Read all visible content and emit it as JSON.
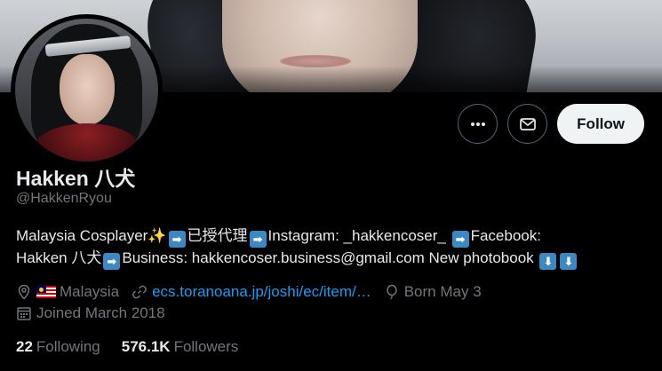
{
  "profile": {
    "display_name": "Hakken 八犬",
    "handle": "@HakkenRyou",
    "bio": {
      "line1_a": "Malaysia Cosplayer",
      "line1_b": "已授代理",
      "line1_c": "Instagram: _hakkencoser_",
      "line1_d": "Facebook:",
      "line2_a": "Hakken 八犬",
      "line2_b": "Business: hakkencoser.business@gmail.com  New photobook",
      "emoji_arrow": "➡",
      "emoji_down": "⬇",
      "emoji_sparkle": "✨"
    },
    "location": "Malaysia",
    "website": "ecs.toranoana.jp/joshi/ec/item/…",
    "birthday": "Born May 3",
    "joined": "Joined March 2018",
    "following_count": "22",
    "following_label": "Following",
    "followers_count": "576.1K",
    "followers_label": "Followers"
  },
  "actions": {
    "more_icon": "more-icon",
    "message_icon": "envelope-icon",
    "follow_label": "Follow"
  },
  "colors": {
    "background": "#000000",
    "link": "#1d9bf0",
    "secondary_text": "#71767b",
    "follow_button": "#eff3f4"
  }
}
